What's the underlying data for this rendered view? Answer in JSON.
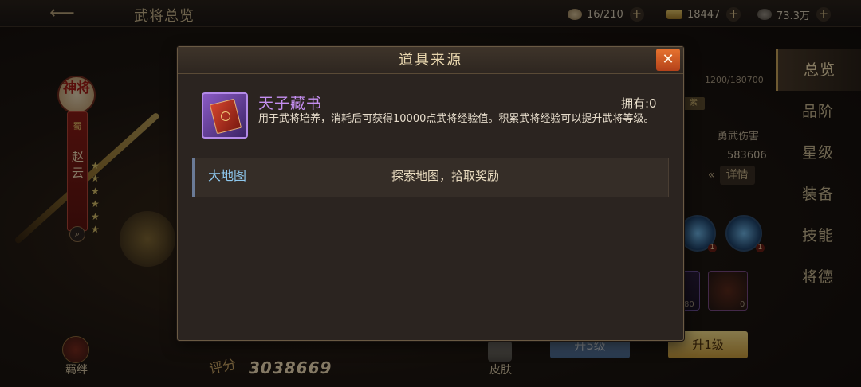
{
  "topbar": {
    "back_icon": "arrow-left-icon",
    "title": "武将总览",
    "resources": [
      {
        "icon": "food-icon",
        "value": "16/210",
        "plus": "+"
      },
      {
        "icon": "gold-ingot-icon",
        "value": "18447",
        "plus": "+"
      },
      {
        "icon": "coin-icon",
        "value": "73.3万",
        "plus": "+"
      }
    ]
  },
  "hero": {
    "badge": "神将",
    "kingdom": "蜀",
    "name": "赵云",
    "stars": [
      "★",
      "★",
      "★",
      "★",
      "★",
      "★"
    ],
    "search_icon": "⌕"
  },
  "bottom": {
    "bond_label": "羁绊",
    "score_label": "评分",
    "score_value": "3038669",
    "skin_label": "皮肤",
    "upgrade5_label": "升5级",
    "upgrade1_label": "升1级"
  },
  "right_panel": {
    "xp": "1200/180700",
    "badge": "紫",
    "stat_name": "勇武伤害",
    "stat_value": "583606",
    "detail_label": "详情",
    "detail_chevron": "«",
    "skill_counts": [
      "1",
      "1"
    ],
    "item_counts": [
      "80",
      "0"
    ]
  },
  "side_tabs": [
    "总览",
    "品阶",
    "星级",
    "装备",
    "技能",
    "将德"
  ],
  "dialog": {
    "title": "道具来源",
    "close_label": "✕",
    "item": {
      "name": "天子藏书",
      "owned": "拥有:0",
      "description": "用于武将培养，消耗后可获得10000点武将经验值。积累武将经验可以提升武将等级。"
    },
    "sources": [
      {
        "name": "大地图",
        "description": "探索地图，拾取奖励"
      }
    ]
  },
  "colors": {
    "item_name_purple": "#c48ef0",
    "source_link_blue": "#8ec8ee",
    "close_orange": "#e7732f",
    "upgrade_gold": "#f4dc8a"
  }
}
